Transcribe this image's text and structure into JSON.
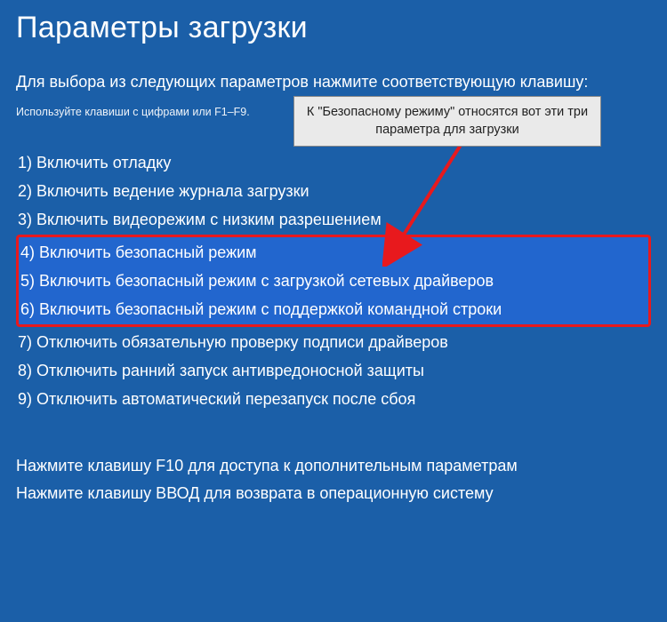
{
  "title": "Параметры загрузки",
  "subtitle": "Для выбора из следующих параметров нажмите соответствующую клавишу:",
  "hint": "Используйте клавиши с цифрами или F1–F9.",
  "options": [
    {
      "num": "1)",
      "label": "Включить отладку"
    },
    {
      "num": "2)",
      "label": "Включить ведение журнала загрузки"
    },
    {
      "num": "3)",
      "label": "Включить видеорежим с низким разрешением"
    },
    {
      "num": "4)",
      "label": "Включить безопасный режим"
    },
    {
      "num": "5)",
      "label": "Включить безопасный режим с загрузкой сетевых драйверов"
    },
    {
      "num": "6)",
      "label": "Включить безопасный режим с поддержкой командной строки"
    },
    {
      "num": "7)",
      "label": "Отключить обязательную проверку подписи драйверов"
    },
    {
      "num": "8)",
      "label": "Отключить ранний запуск антивредоносной защиты"
    },
    {
      "num": "9)",
      "label": "Отключить автоматический перезапуск после сбоя"
    }
  ],
  "footer1": "Нажмите клавишу F10 для доступа к дополнительным параметрам",
  "footer2": "Нажмите клавишу ВВОД для возврата в операционную систему",
  "annotation": "К \"Безопасному режиму\" относятся вот эти три параметра для загрузки",
  "colors": {
    "background": "#1b5fa8",
    "highlight_bg": "#2266ce",
    "highlight_border": "#e8191d"
  }
}
